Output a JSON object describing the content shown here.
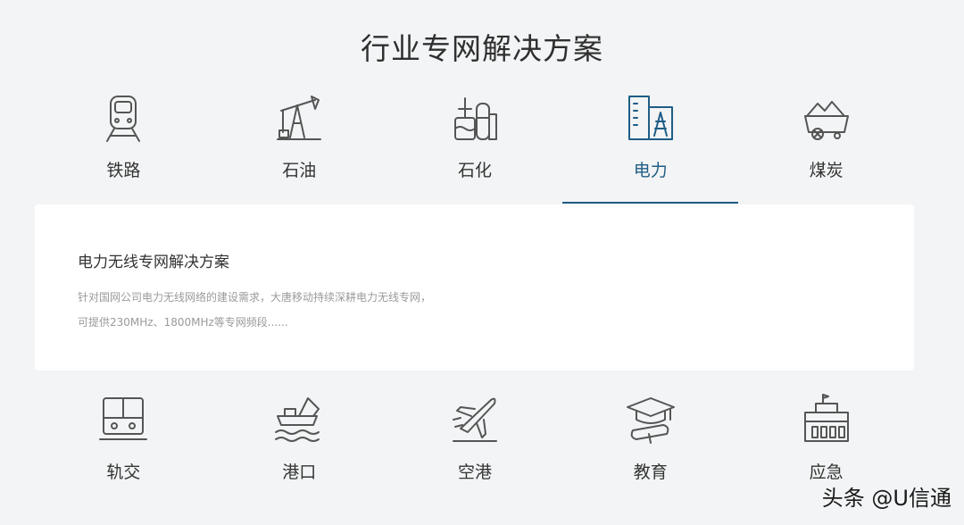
{
  "page_title": "行业专网解决方案",
  "top_tabs": [
    {
      "label": "铁路",
      "icon": "train-icon"
    },
    {
      "label": "石油",
      "icon": "oil-pump-icon"
    },
    {
      "label": "石化",
      "icon": "petrochemical-plant-icon"
    },
    {
      "label": "电力",
      "icon": "power-station-icon",
      "active": true
    },
    {
      "label": "煤炭",
      "icon": "coal-cart-icon"
    }
  ],
  "panel": {
    "title": "电力无线专网解决方案",
    "description": "针对国网公司电力无线网络的建设需求，大唐移动持续深耕电力无线专网，可提供230MHz、1800MHz等专网频段......"
  },
  "bottom_tabs": [
    {
      "label": "轨交",
      "icon": "rail-transit-icon"
    },
    {
      "label": "港口",
      "icon": "port-ship-icon"
    },
    {
      "label": "空港",
      "icon": "airplane-icon"
    },
    {
      "label": "教育",
      "icon": "graduation-cap-icon"
    },
    {
      "label": "应急",
      "icon": "emergency-building-icon"
    }
  ],
  "watermark": "头条 @U信通",
  "colors": {
    "accent": "#1f5d86",
    "background": "#f3f4f5",
    "panel": "#ffffff"
  }
}
